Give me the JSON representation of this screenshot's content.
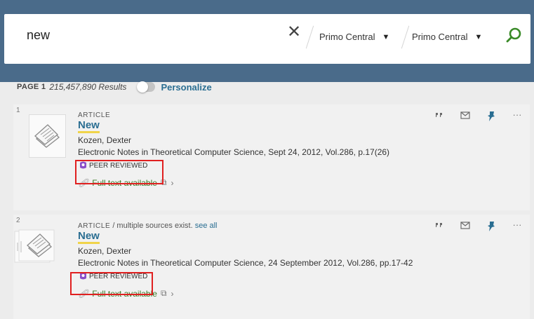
{
  "search": {
    "query": "new",
    "scopes": [
      "Primo Central",
      "Primo Central"
    ]
  },
  "results_header": {
    "page_label": "PAGE 1",
    "count": "215,457,890 Results",
    "personalize": "Personalize"
  },
  "results": [
    {
      "number": "1",
      "type": "ARTICLE",
      "type_suffix": "",
      "see_all": "",
      "title": "New",
      "author": "Kozen, Dexter",
      "source": "Electronic Notes in Theoretical Computer Science, Sept 24, 2012, Vol.286, p.17(26)",
      "peer": "PEER REVIEWED",
      "fulltext": "Full text available"
    },
    {
      "number": "2",
      "type": "ARTICLE",
      "type_suffix": " / multiple sources exist.",
      "see_all": " see all",
      "title": "New",
      "author": "Kozen, Dexter",
      "source": "Electronic Notes in Theoretical Computer Science, 24 September 2012, Vol.286, pp.17-42",
      "peer": "PEER REVIEWED",
      "fulltext": "Full text available"
    }
  ],
  "icons": {
    "cite": "quote-icon",
    "email": "envelope-icon",
    "pin": "pin-icon",
    "more": "more-icon"
  },
  "colors": {
    "accent": "#2a6e92",
    "available": "#3a7a28",
    "highlight_box": "#e02020",
    "peer_badge": "#8b4fc9",
    "header": "#4a6b8a"
  }
}
